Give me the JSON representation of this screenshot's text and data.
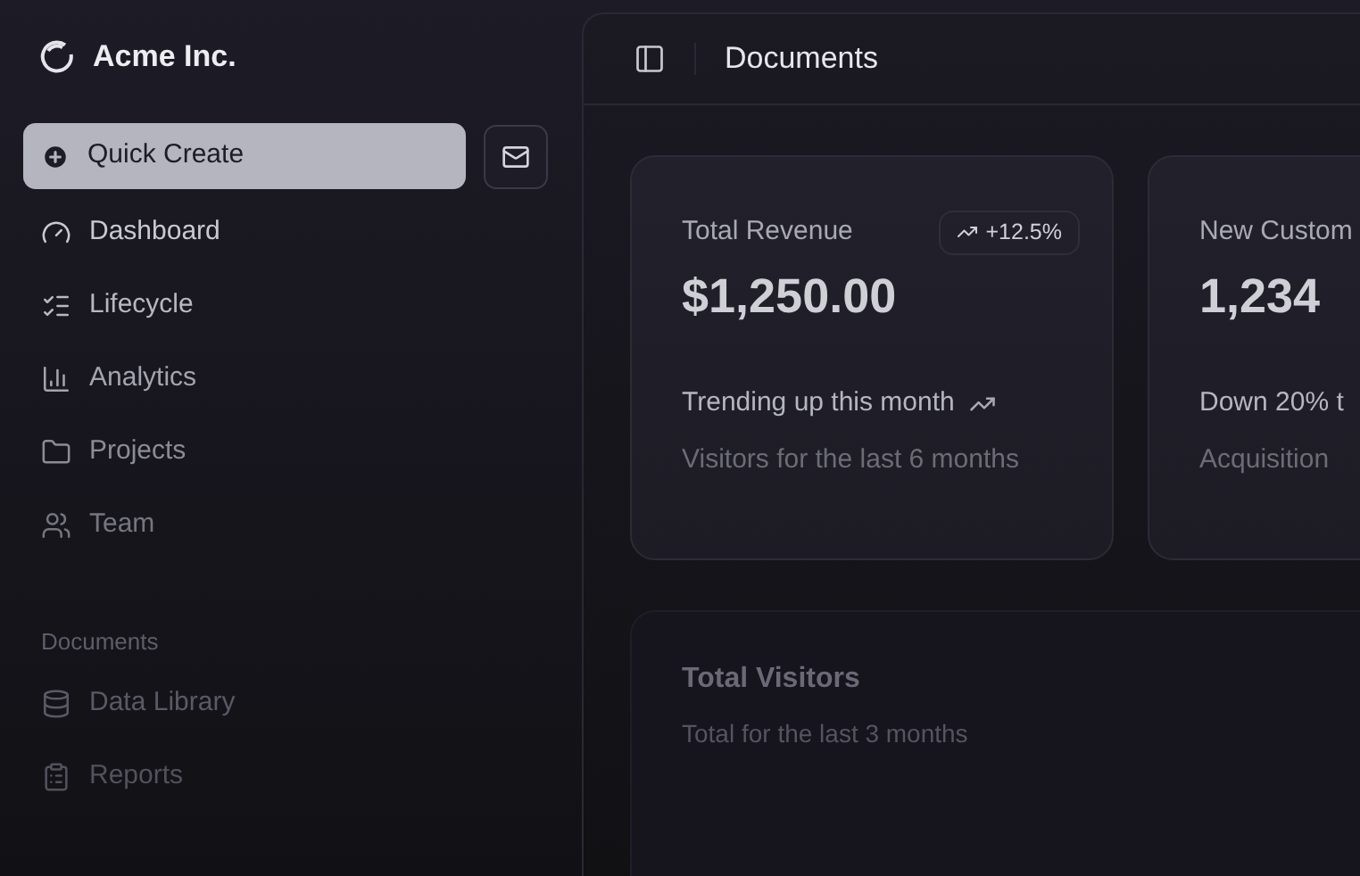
{
  "sidebar": {
    "brand": "Acme Inc.",
    "quick_create": "Quick Create",
    "nav_items": [
      {
        "label": "Dashboard"
      },
      {
        "label": "Lifecycle"
      },
      {
        "label": "Analytics"
      },
      {
        "label": "Projects"
      },
      {
        "label": "Team"
      }
    ],
    "section_title": "Documents",
    "document_items": [
      {
        "label": "Data Library"
      },
      {
        "label": "Reports"
      }
    ]
  },
  "header": {
    "title": "Documents"
  },
  "cards": [
    {
      "title": "Total Revenue",
      "value": "$1,250.00",
      "badge": "+12.5%",
      "trend": "Trending up this month",
      "note": "Visitors for the last 6 months"
    },
    {
      "title": "New Custom",
      "value": "1,234",
      "trend": "Down 20% t",
      "note": "Acquisition"
    }
  ],
  "visitors_card": {
    "title": "Total Visitors",
    "subtitle": "Total for the last 3 months"
  }
}
